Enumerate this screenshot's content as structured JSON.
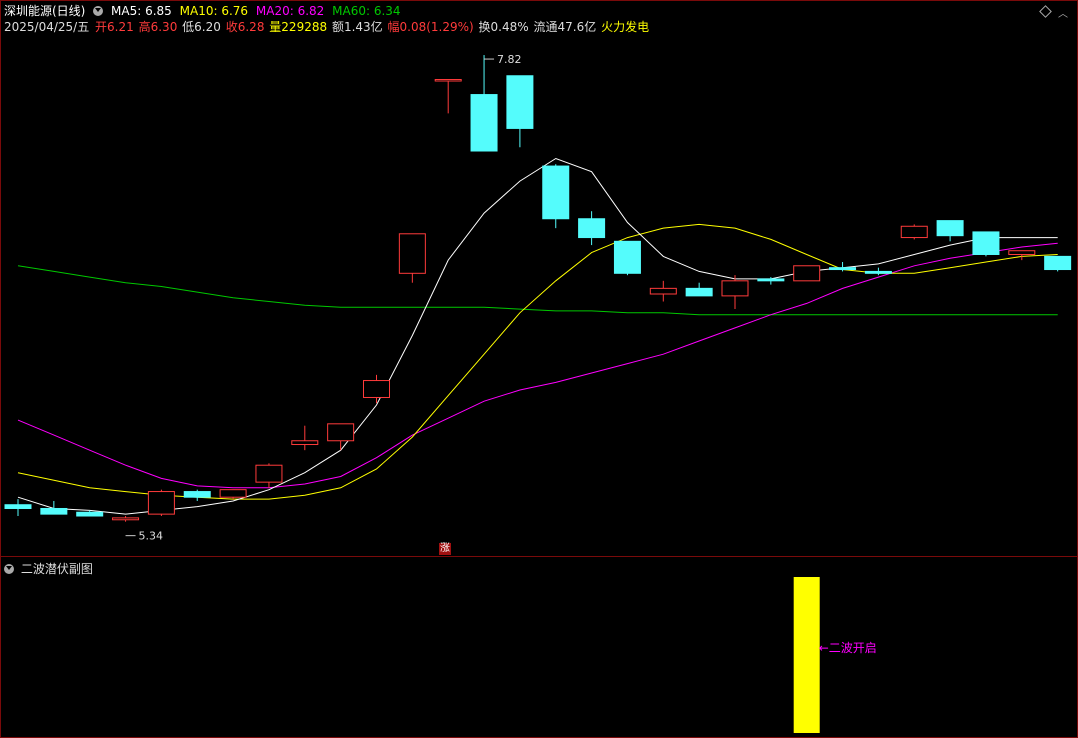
{
  "header": {
    "title": "深圳能源(日线)",
    "ma5": "MA5: 6.85",
    "ma10": "MA10: 6.76",
    "ma20": "MA20: 6.82",
    "ma60": "MA60: 6.34",
    "date": "2025/04/25/五",
    "open": "开6.21",
    "high": "高6.30",
    "low": "低6.20",
    "close": "收6.28",
    "volume": "量229288",
    "amount": "额1.43亿",
    "change": "幅0.08(1.29%)",
    "turnover": "换0.48%",
    "float_cap": "流通47.6亿",
    "sector": "火力发电"
  },
  "colors": {
    "up": "#ff3b3b",
    "down": "#54fcfc",
    "ma5": "#ffffff",
    "ma10": "#ffff00",
    "ma20": "#ff00ff",
    "ma60": "#00c800",
    "signal": "#ffff00"
  },
  "annotations": {
    "high_label": "7.82",
    "low_label": "5.34",
    "zhang_badge": "涨"
  },
  "sub_panel": {
    "title": "二波潜伏副图",
    "signal_label": "←二波开启",
    "signal_index": 22
  },
  "chart_data": {
    "type": "candlestick",
    "y_range": [
      5.2,
      7.9
    ],
    "candles": [
      {
        "o": 5.43,
        "h": 5.46,
        "l": 5.37,
        "c": 5.41
      },
      {
        "o": 5.41,
        "h": 5.45,
        "l": 5.38,
        "c": 5.38
      },
      {
        "o": 5.39,
        "h": 5.4,
        "l": 5.37,
        "c": 5.37
      },
      {
        "o": 5.35,
        "h": 5.37,
        "l": 5.34,
        "c": 5.36
      },
      {
        "o": 5.38,
        "h": 5.51,
        "l": 5.37,
        "c": 5.5
      },
      {
        "o": 5.5,
        "h": 5.51,
        "l": 5.45,
        "c": 5.47
      },
      {
        "o": 5.47,
        "h": 5.51,
        "l": 5.46,
        "c": 5.51
      },
      {
        "o": 5.55,
        "h": 5.65,
        "l": 5.52,
        "c": 5.64
      },
      {
        "o": 5.75,
        "h": 5.85,
        "l": 5.72,
        "c": 5.77
      },
      {
        "o": 5.77,
        "h": 5.86,
        "l": 5.72,
        "c": 5.86
      },
      {
        "o": 6.0,
        "h": 6.12,
        "l": 5.97,
        "c": 6.09
      },
      {
        "o": 6.66,
        "h": 6.87,
        "l": 6.61,
        "c": 6.87
      },
      {
        "o": 7.69,
        "h": 7.69,
        "l": 7.51,
        "c": 7.69
      },
      {
        "o": 7.61,
        "h": 7.82,
        "l": 7.31,
        "c": 7.31
      },
      {
        "o": 7.71,
        "h": 7.71,
        "l": 7.33,
        "c": 7.43
      },
      {
        "o": 7.23,
        "h": 7.24,
        "l": 6.9,
        "c": 6.95
      },
      {
        "o": 6.95,
        "h": 6.99,
        "l": 6.81,
        "c": 6.85
      },
      {
        "o": 6.83,
        "h": 6.83,
        "l": 6.65,
        "c": 6.66
      },
      {
        "o": 6.55,
        "h": 6.62,
        "l": 6.51,
        "c": 6.58
      },
      {
        "o": 6.58,
        "h": 6.61,
        "l": 6.54,
        "c": 6.54
      },
      {
        "o": 6.54,
        "h": 6.65,
        "l": 6.47,
        "c": 6.62
      },
      {
        "o": 6.63,
        "h": 6.64,
        "l": 6.6,
        "c": 6.62
      },
      {
        "o": 6.62,
        "h": 6.7,
        "l": 6.62,
        "c": 6.7
      },
      {
        "o": 6.69,
        "h": 6.72,
        "l": 6.67,
        "c": 6.68
      },
      {
        "o": 6.67,
        "h": 6.69,
        "l": 6.65,
        "c": 6.66
      },
      {
        "o": 6.85,
        "h": 6.92,
        "l": 6.84,
        "c": 6.91
      },
      {
        "o": 6.94,
        "h": 6.94,
        "l": 6.83,
        "c": 6.86
      },
      {
        "o": 6.88,
        "h": 6.88,
        "l": 6.75,
        "c": 6.76
      },
      {
        "o": 6.76,
        "h": 6.78,
        "l": 6.73,
        "c": 6.78
      },
      {
        "o": 6.75,
        "h": 6.75,
        "l": 6.67,
        "c": 6.68
      }
    ],
    "ma5": [
      5.47,
      5.41,
      5.4,
      5.38,
      5.4,
      5.42,
      5.45,
      5.51,
      5.6,
      5.72,
      5.96,
      6.33,
      6.73,
      6.98,
      7.15,
      7.27,
      7.2,
      6.93,
      6.75,
      6.67,
      6.63,
      6.63,
      6.67,
      6.69,
      6.71,
      6.76,
      6.81,
      6.85,
      6.85,
      6.85
    ],
    "ma10": [
      5.6,
      5.56,
      5.52,
      5.5,
      5.48,
      5.47,
      5.46,
      5.46,
      5.48,
      5.52,
      5.62,
      5.79,
      6.01,
      6.23,
      6.45,
      6.62,
      6.77,
      6.85,
      6.9,
      6.92,
      6.9,
      6.84,
      6.76,
      6.68,
      6.66,
      6.66,
      6.69,
      6.72,
      6.75,
      6.76
    ],
    "ma20": [
      5.88,
      5.8,
      5.72,
      5.64,
      5.57,
      5.53,
      5.52,
      5.52,
      5.54,
      5.58,
      5.68,
      5.8,
      5.89,
      5.98,
      6.04,
      6.08,
      6.13,
      6.18,
      6.23,
      6.3,
      6.37,
      6.44,
      6.5,
      6.58,
      6.64,
      6.7,
      6.74,
      6.77,
      6.8,
      6.82
    ],
    "ma60": [
      6.7,
      6.67,
      6.64,
      6.61,
      6.59,
      6.56,
      6.53,
      6.51,
      6.49,
      6.48,
      6.48,
      6.48,
      6.48,
      6.48,
      6.47,
      6.46,
      6.46,
      6.45,
      6.45,
      6.44,
      6.44,
      6.44,
      6.44,
      6.44,
      6.44,
      6.44,
      6.44,
      6.44,
      6.44,
      6.44
    ]
  }
}
